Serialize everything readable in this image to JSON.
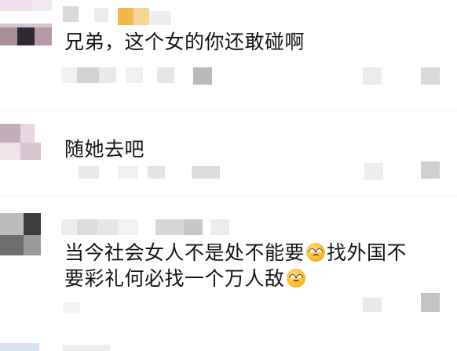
{
  "comments": [
    {
      "text": "兄弟，这个女的你还敢碰啊"
    },
    {
      "text": "随她去吧"
    },
    {
      "line1_a": "当今社会女人不是处不能要",
      "line1_b": "找外国不",
      "line2_a": "要彩礼何必找一个万人敌"
    }
  ],
  "icons": [
    "avatar-mosaic",
    "emoji-rolling-eyes"
  ]
}
